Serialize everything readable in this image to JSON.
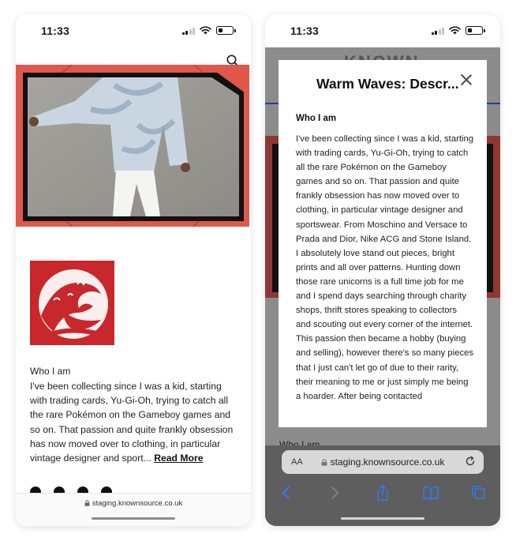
{
  "left_phone": {
    "status_time": "11:33",
    "excerpt": {
      "heading": "Who I am",
      "text": "I've been collecting since I was a kid, starting with trading cards, Yu-Gi-Oh, trying to catch all the rare Pokémon on the Gameboy games and so on. That passion and quite frankly obsession has now moved over to clothing, in particular vintage designer and sport...",
      "read_more": "Read More"
    },
    "url": "staging.knownsource.co.uk",
    "social_icons": [
      "facebook-icon",
      "twitter-icon",
      "pinterest-icon",
      "tumblr-icon"
    ]
  },
  "right_phone": {
    "status_time": "11:33",
    "background_logo": "KNOWN",
    "background_who": "Who I am",
    "modal": {
      "title": "Warm Waves: Descr...",
      "heading": "Who I am",
      "paragraphs": [
        "I've been collecting since I was a kid, starting with trading cards, Yu-Gi-Oh, trying to catch all the rare Pokémon on the Gameboy games and so on. That passion and quite frankly obsession has now moved over to clothing, in particular vintage designer and sportswear. From Moschino and Versace to Prada and Dior, Nike ACG and Stone Island. I absolutely love stand out pieces, bright prints and all over patterns. Hunting down those rare unicorns is a full time job for me and I spend days searching through charity shops, thrift stores speaking to collectors and scouting out every corner of the internet.",
        "This passion then became a hobby (buying and selling), however there's so many pieces that I just can't let go of due to their rarity, their meaning to me or just simply me being a hoarder. After being contacted"
      ]
    },
    "safari": {
      "aa_label": "AA",
      "url": "staging.knownsource.co.uk"
    }
  },
  "colors": {
    "hero_red": "#e1574c",
    "link_blue": "#3478f6",
    "wave_red": "#c8272c"
  }
}
